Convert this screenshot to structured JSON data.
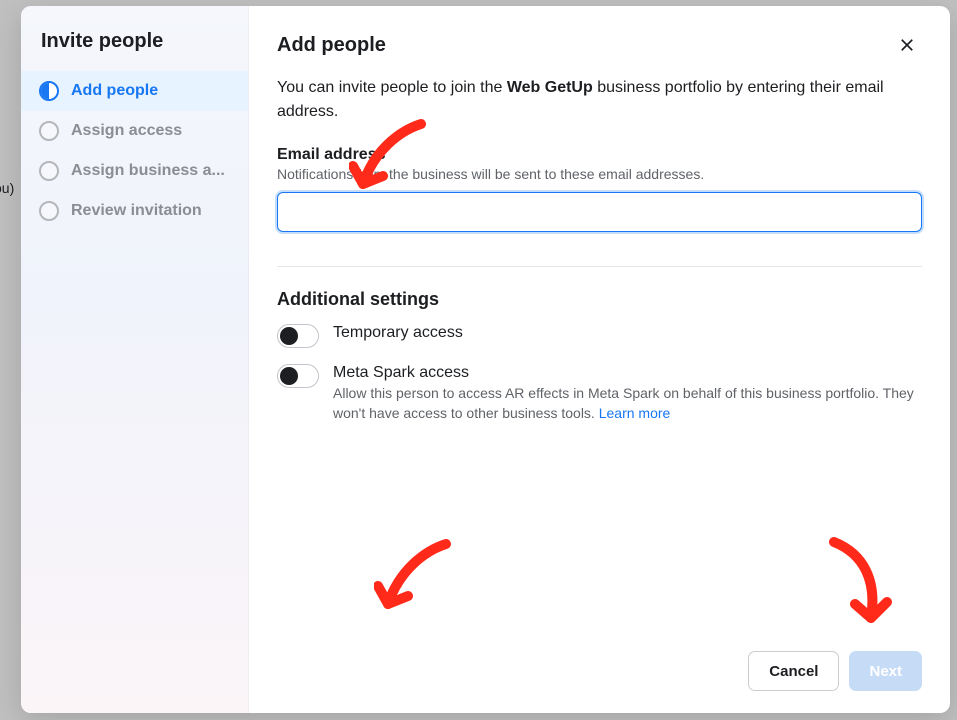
{
  "backdrop": {
    "left_fragment": "ou)"
  },
  "sidebar": {
    "title": "Invite people",
    "steps": [
      {
        "label": "Add people",
        "active": true
      },
      {
        "label": "Assign access",
        "active": false
      },
      {
        "label": "Assign business a...",
        "active": false
      },
      {
        "label": "Review invitation",
        "active": false
      }
    ]
  },
  "main": {
    "title": "Add people",
    "intro_prefix": "You can invite people to join the ",
    "intro_bold": "Web GetUp",
    "intro_suffix": " business portfolio by entering their email address.",
    "email": {
      "label": "Email address",
      "hint": "Notifications from the business will be sent to these email addresses.",
      "value": ""
    },
    "additional": {
      "heading": "Additional settings",
      "temporary": {
        "label": "Temporary access"
      },
      "metaspark": {
        "label": "Meta Spark access",
        "desc_prefix": "Allow this person to access AR effects in Meta Spark on behalf of this business portfolio. They won't have access to other business tools. ",
        "learn_more": "Learn more"
      }
    },
    "footer": {
      "cancel": "Cancel",
      "next": "Next"
    }
  }
}
